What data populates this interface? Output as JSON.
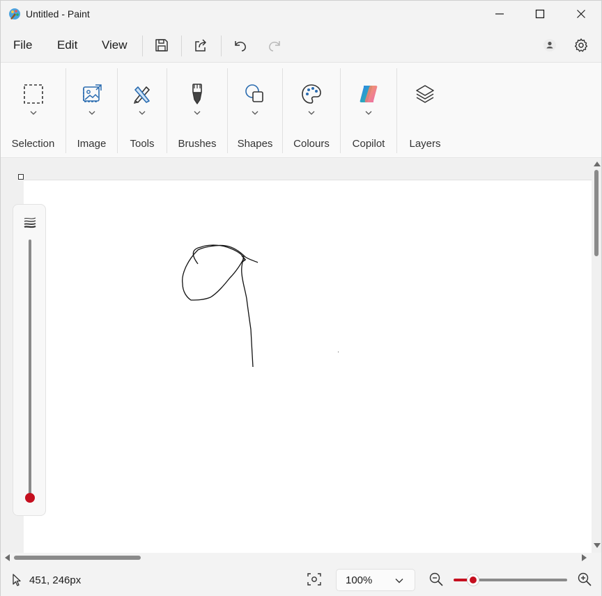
{
  "window": {
    "title": "Untitled - Paint",
    "app_icon": "paint-app-icon"
  },
  "menu": {
    "file": "File",
    "edit": "Edit",
    "view": "View",
    "icons": [
      "save-icon",
      "share-icon",
      "undo-icon",
      "redo-icon",
      "account-icon",
      "settings-icon"
    ]
  },
  "ribbon": {
    "groups": [
      {
        "label": "Selection",
        "icon": "selection-icon",
        "has_dropdown": true
      },
      {
        "label": "Image",
        "icon": "image-icon",
        "has_dropdown": true
      },
      {
        "label": "Tools",
        "icon": "tools-icon",
        "has_dropdown": true
      },
      {
        "label": "Brushes",
        "icon": "brush-icon",
        "has_dropdown": true
      },
      {
        "label": "Shapes",
        "icon": "shapes-icon",
        "has_dropdown": true
      },
      {
        "label": "Colours",
        "icon": "palette-icon",
        "has_dropdown": true
      },
      {
        "label": "Copilot",
        "icon": "copilot-icon",
        "has_dropdown": true
      },
      {
        "label": "Layers",
        "icon": "layers-icon",
        "has_dropdown": false
      }
    ]
  },
  "brush_size": {
    "color": "#c50f1f"
  },
  "status": {
    "coordinates": "451, 246px",
    "zoom": "100%",
    "accent": "#c50f1f"
  }
}
